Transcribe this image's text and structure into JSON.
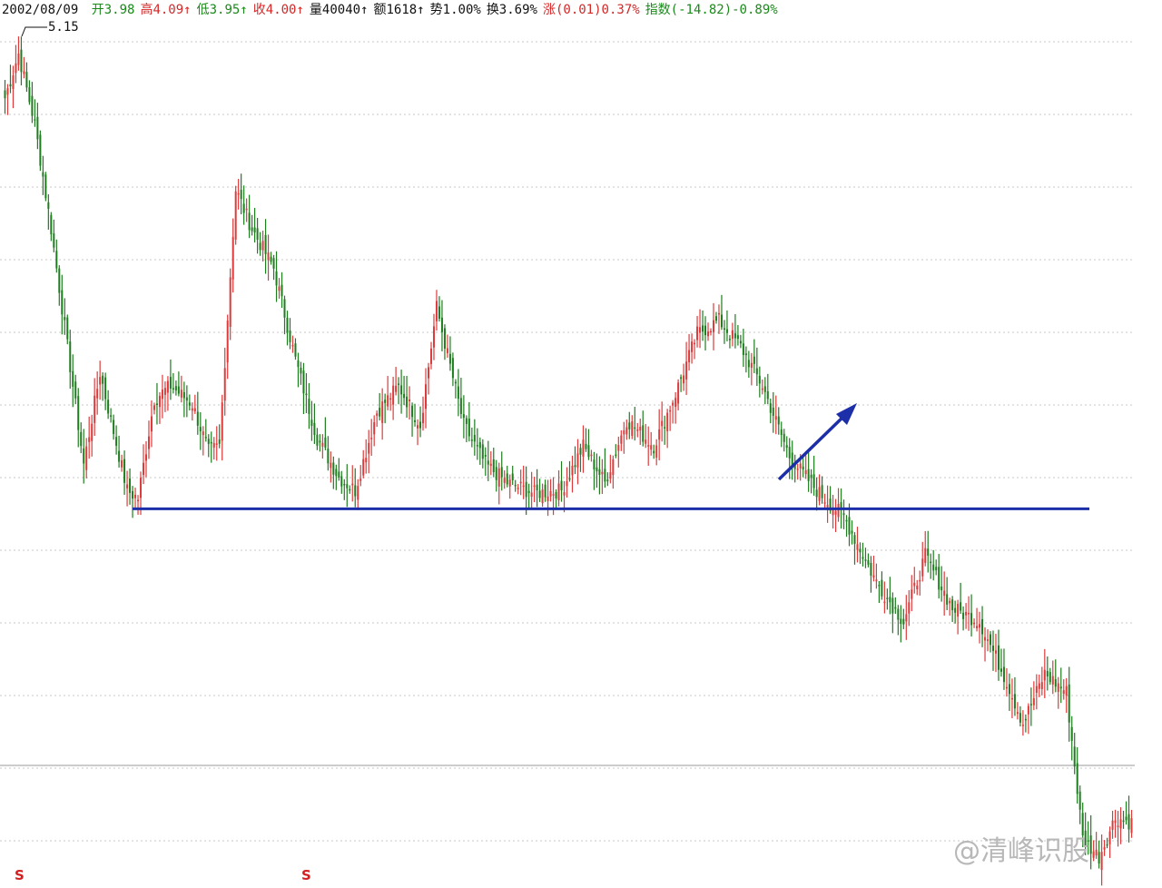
{
  "info_bar": {
    "date": "2002/08/09",
    "fields": [
      {
        "label": "开",
        "value": "3.98",
        "color": "#1a8a1a"
      },
      {
        "label": "高",
        "value": "4.09↑",
        "color": "#d42828"
      },
      {
        "label": "低",
        "value": "3.95↑",
        "color": "#1a8a1a"
      },
      {
        "label": "收",
        "value": "4.00↑",
        "color": "#d42828"
      },
      {
        "label": "量",
        "value": "40040↑",
        "color": "#111111"
      },
      {
        "label": "额",
        "value": "1618↑",
        "color": "#111111"
      },
      {
        "label": "势",
        "value": "1.00%",
        "color": "#111111"
      },
      {
        "label": "换",
        "value": "3.69%",
        "color": "#111111"
      },
      {
        "label": "涨",
        "value": "(0.01)0.37%",
        "color": "#d42828"
      },
      {
        "label": "指数",
        "value": "(-14.82)-0.89%",
        "color": "#1a8a1a"
      }
    ]
  },
  "chart_data": {
    "type": "candlestick",
    "high_marker": "5.15",
    "colors": {
      "up": "#dd3b3b",
      "down": "#1e7d1e",
      "support_line": "#1c2fa8",
      "arrow": "#1c2fa8",
      "grid": "#c8c8c8"
    },
    "gridlines_dotted": true,
    "support_line_level": 3.38,
    "y_range_est": [
      2.0,
      5.2
    ],
    "anchor_prices_est": [
      [
        1,
        4.95
      ],
      [
        6,
        5.12
      ],
      [
        12,
        4.85
      ],
      [
        18,
        4.45
      ],
      [
        24,
        4.0
      ],
      [
        30,
        3.55
      ],
      [
        36,
        3.9
      ],
      [
        40,
        3.72
      ],
      [
        46,
        3.45
      ],
      [
        50,
        3.42
      ],
      [
        56,
        3.8
      ],
      [
        62,
        3.85
      ],
      [
        70,
        3.78
      ],
      [
        76,
        3.6
      ],
      [
        80,
        3.62
      ],
      [
        86,
        4.6
      ],
      [
        92,
        4.45
      ],
      [
        100,
        4.3
      ],
      [
        108,
        3.95
      ],
      [
        116,
        3.65
      ],
      [
        124,
        3.5
      ],
      [
        130,
        3.45
      ],
      [
        138,
        3.75
      ],
      [
        146,
        3.85
      ],
      [
        154,
        3.7
      ],
      [
        160,
        4.15
      ],
      [
        170,
        3.7
      ],
      [
        178,
        3.55
      ],
      [
        186,
        3.48
      ],
      [
        196,
        3.44
      ],
      [
        206,
        3.45
      ],
      [
        214,
        3.62
      ],
      [
        222,
        3.48
      ],
      [
        230,
        3.72
      ],
      [
        240,
        3.62
      ],
      [
        248,
        3.82
      ],
      [
        256,
        4.05
      ],
      [
        264,
        4.1
      ],
      [
        272,
        4.0
      ],
      [
        280,
        3.85
      ],
      [
        290,
        3.58
      ],
      [
        300,
        3.45
      ],
      [
        310,
        3.35
      ],
      [
        322,
        3.1
      ],
      [
        332,
        2.95
      ],
      [
        340,
        3.2
      ],
      [
        350,
        3.0
      ],
      [
        360,
        2.95
      ],
      [
        370,
        2.72
      ],
      [
        376,
        2.56
      ],
      [
        384,
        2.75
      ],
      [
        392,
        2.68
      ],
      [
        398,
        2.12
      ],
      [
        404,
        2.05
      ],
      [
        410,
        2.2
      ],
      [
        416,
        2.18
      ]
    ]
  },
  "watermark": "@清峰识股",
  "bottom_markers": [
    "S",
    "S"
  ]
}
